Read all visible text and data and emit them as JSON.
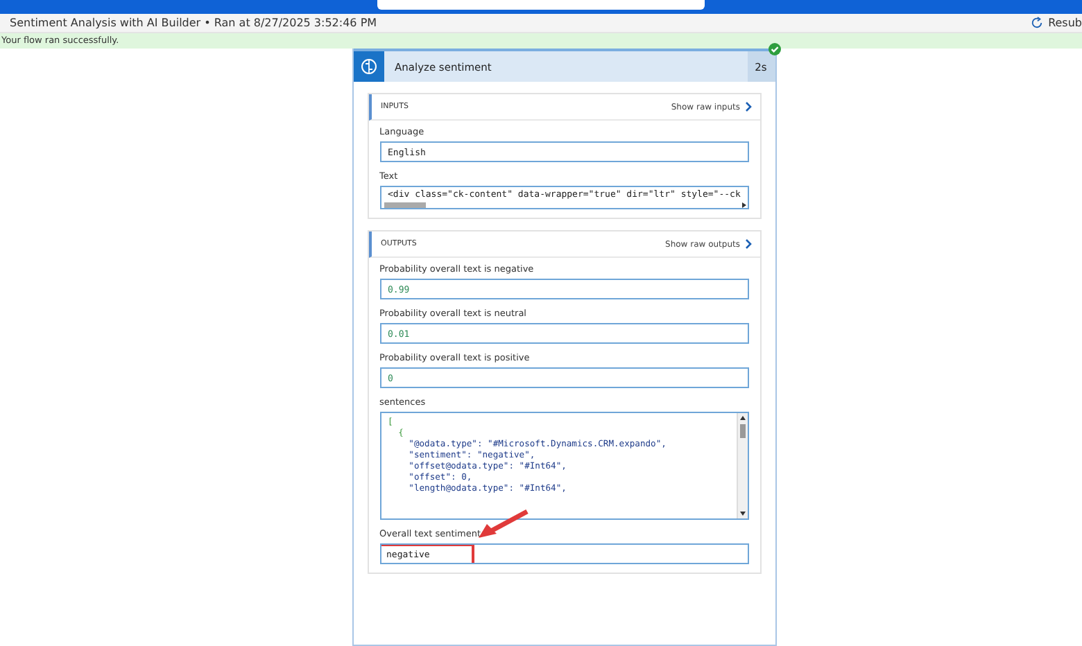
{
  "header": {
    "action": "Resub"
  },
  "run_bar": {
    "title": "Sentiment Analysis with AI Builder • Ran at 8/27/2025 3:52:46 PM"
  },
  "status": {
    "message": "Your flow ran successfully.",
    "succeeded": true
  },
  "action_card": {
    "title": "Analyze sentiment",
    "duration": "2s",
    "inputs": {
      "heading": "INPUTS",
      "raw_link": "Show raw inputs",
      "fields": [
        {
          "label": "Language",
          "value": "English",
          "kind": "text"
        },
        {
          "label": "Text",
          "value": "<div class=\"ck-content\" data-wrapper=\"true\" dir=\"ltr\" style=\"--ck",
          "kind": "scroll"
        }
      ]
    },
    "outputs": {
      "heading": "OUTPUTS",
      "raw_link": "Show raw outputs",
      "fields": [
        {
          "label": "Probability overall text is negative",
          "value": "0.99",
          "kind": "number",
          "highlighted": false
        },
        {
          "label": "Probability overall text is neutral",
          "value": "0.01",
          "kind": "number",
          "highlighted": false
        },
        {
          "label": "Probability overall text is positive",
          "value": "0",
          "kind": "number",
          "highlighted": false
        },
        {
          "label": "sentences",
          "kind": "code",
          "lines": [
            {
              "text": "[",
              "kind": "bracket"
            },
            {
              "text": "  {",
              "kind": "bracket"
            },
            {
              "text": "    \"@odata.type\": \"#Microsoft.Dynamics.CRM.expando\",",
              "kind": "entry"
            },
            {
              "text": "    \"sentiment\": \"negative\",",
              "kind": "entry"
            },
            {
              "text": "    \"offset@odata.type\": \"#Int64\",",
              "kind": "entry"
            },
            {
              "text": "    \"offset\": 0,",
              "kind": "entry"
            },
            {
              "text": "    \"length@odata.type\": \"#Int64\",",
              "kind": "entry"
            }
          ],
          "highlighted": false
        },
        {
          "label": "Overall text sentiment",
          "value": "negative",
          "kind": "text",
          "highlighted": true
        }
      ]
    }
  }
}
